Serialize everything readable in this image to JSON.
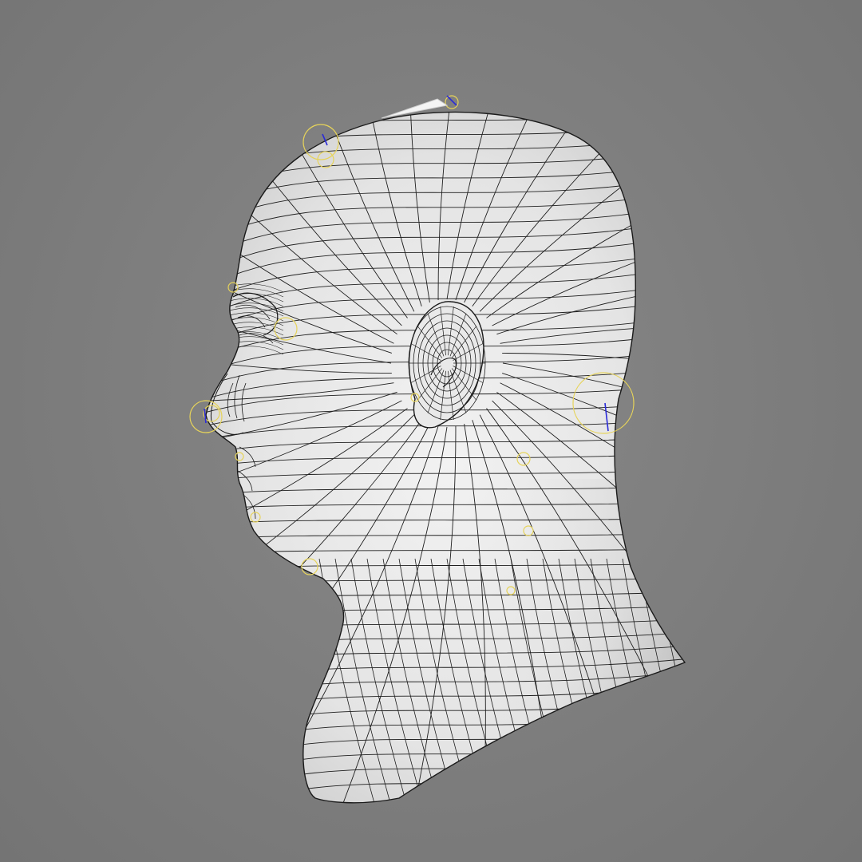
{
  "viewport": {
    "background_color": "#7d7d7d",
    "mesh_fill_color": "#e8e8e8",
    "wire_color": "#1f1f1f",
    "rig_control_color": "#e6d35a",
    "axis_color": "#2a2ad8"
  },
  "object": {
    "icon": "wireframe-head-mesh",
    "view": "side-profile"
  }
}
